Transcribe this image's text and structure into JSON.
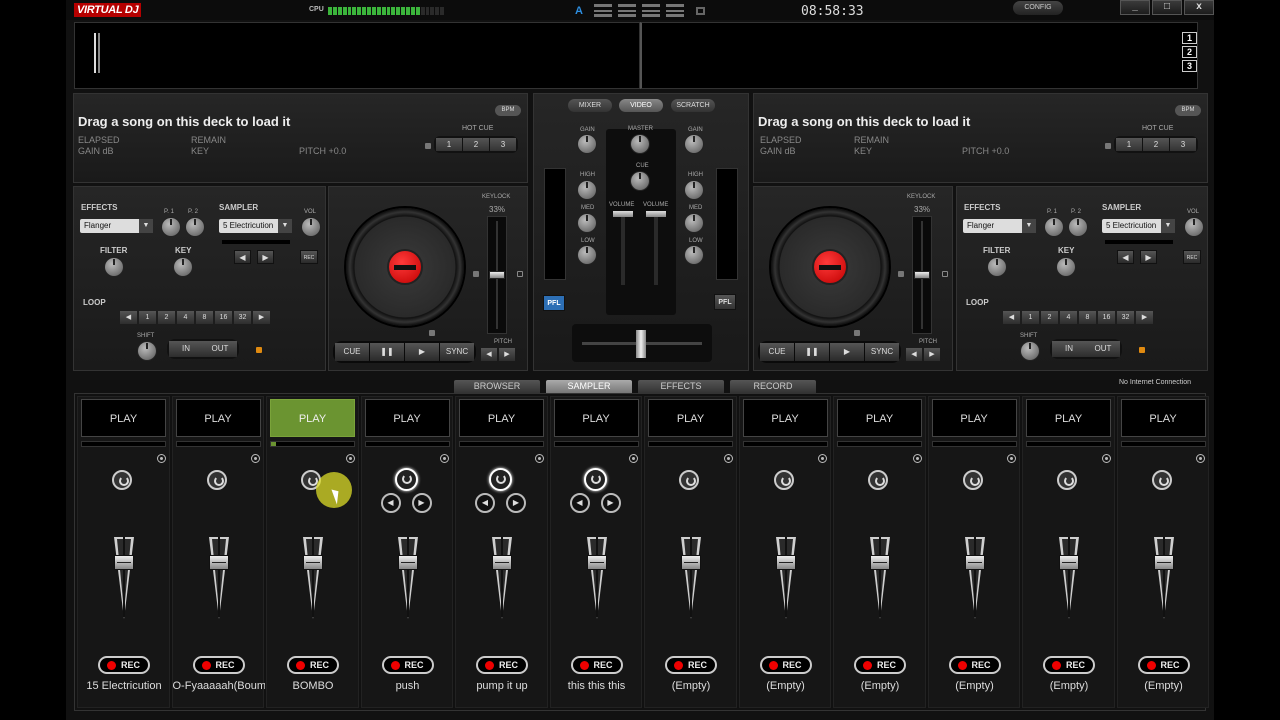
{
  "titlebar": {
    "logo": "VIRTUAL DJ",
    "cpu_label": "CPU",
    "cpu_level": 0.78,
    "layout_letter": "A",
    "clock": "08:58:33",
    "config_label": "CONFIG",
    "window_buttons": [
      "_",
      "□",
      "x"
    ]
  },
  "deck_selector": [
    "1",
    "2",
    "3"
  ],
  "decks": [
    {
      "message": "Drag a song on this deck to load it",
      "bpm_label": "BPM",
      "elapsed": "ELAPSED",
      "gain": "GAIN dB",
      "remain": "REMAIN",
      "key": "KEY",
      "pitch": "PITCH +0.0",
      "hotcue_label": "HOT CUE",
      "hotcues": [
        "1",
        "2",
        "3"
      ],
      "effects_label": "EFFECTS",
      "effect_value": "Flanger",
      "p1": "P. 1",
      "p2": "P. 2",
      "sampler_label": "SAMPLER",
      "sampler_value": "5 Electricution",
      "vol": "VOL",
      "rec": "REC",
      "filter": "FILTER",
      "key_knob": "KEY",
      "loop_label": "LOOP",
      "loop_values": [
        "◀",
        "1",
        "2",
        "4",
        "8",
        "16",
        "32",
        "▶"
      ],
      "shift": "SHIFT",
      "in_label": "IN",
      "out_label": "OUT",
      "keylock": "KEYLOCK",
      "keylock_pct": "33%",
      "transport": [
        "CUE",
        "❚❚",
        "▶",
        "SYNC"
      ],
      "pitch_label": "PITCH"
    },
    {
      "message": "Drag a song on this deck to load it",
      "bpm_label": "BPM",
      "elapsed": "ELAPSED",
      "gain": "GAIN dB",
      "remain": "REMAIN",
      "key": "KEY",
      "pitch": "PITCH +0.0",
      "hotcue_label": "HOT CUE",
      "hotcues": [
        "1",
        "2",
        "3"
      ],
      "effects_label": "EFFECTS",
      "effect_value": "Flanger",
      "p1": "P. 1",
      "p2": "P. 2",
      "sampler_label": "SAMPLER",
      "sampler_value": "5 Electricution",
      "vol": "VOL",
      "rec": "REC",
      "filter": "FILTER",
      "key_knob": "KEY",
      "loop_label": "LOOP",
      "loop_values": [
        "◀",
        "1",
        "2",
        "4",
        "8",
        "16",
        "32",
        "▶"
      ],
      "shift": "SHIFT",
      "in_label": "IN",
      "out_label": "OUT",
      "keylock": "KEYLOCK",
      "keylock_pct": "33%",
      "transport": [
        "CUE",
        "❚❚",
        "▶",
        "SYNC"
      ],
      "pitch_label": "PITCH"
    }
  ],
  "mixer": {
    "tabs": [
      "MIXER",
      "VIDEO",
      "SCRATCH"
    ],
    "active_tab": "VIDEO",
    "gain": "GAIN",
    "master": "MASTER",
    "cue": "CUE",
    "high": "HIGH",
    "med": "MED",
    "low": "LOW",
    "volume": "VOLUME",
    "pfl": "PFL",
    "pfl_left_color": "#2d6fb5"
  },
  "bottom_tabs": [
    "BROWSER",
    "SAMPLER",
    "EFFECTS",
    "RECORD"
  ],
  "active_bottom_tab": "SAMPLER",
  "connection_status": "No Internet Connection",
  "sampler": {
    "play_label": "PLAY",
    "rec_label": "REC",
    "active_color": "#6b9431",
    "slots": [
      {
        "name": "15 Electricution",
        "active": false
      },
      {
        "name": "O-Fyaaaaah(Boum",
        "active": false
      },
      {
        "name": "BOMBO",
        "active": true
      },
      {
        "name": "push",
        "active": false
      },
      {
        "name": "pump it up",
        "active": false
      },
      {
        "name": "this this this",
        "active": false
      },
      {
        "name": "(Empty)",
        "active": false
      },
      {
        "name": "(Empty)",
        "active": false
      },
      {
        "name": "(Empty)",
        "active": false
      },
      {
        "name": "(Empty)",
        "active": false
      },
      {
        "name": "(Empty)",
        "active": false
      },
      {
        "name": "(Empty)",
        "active": false
      }
    ]
  }
}
